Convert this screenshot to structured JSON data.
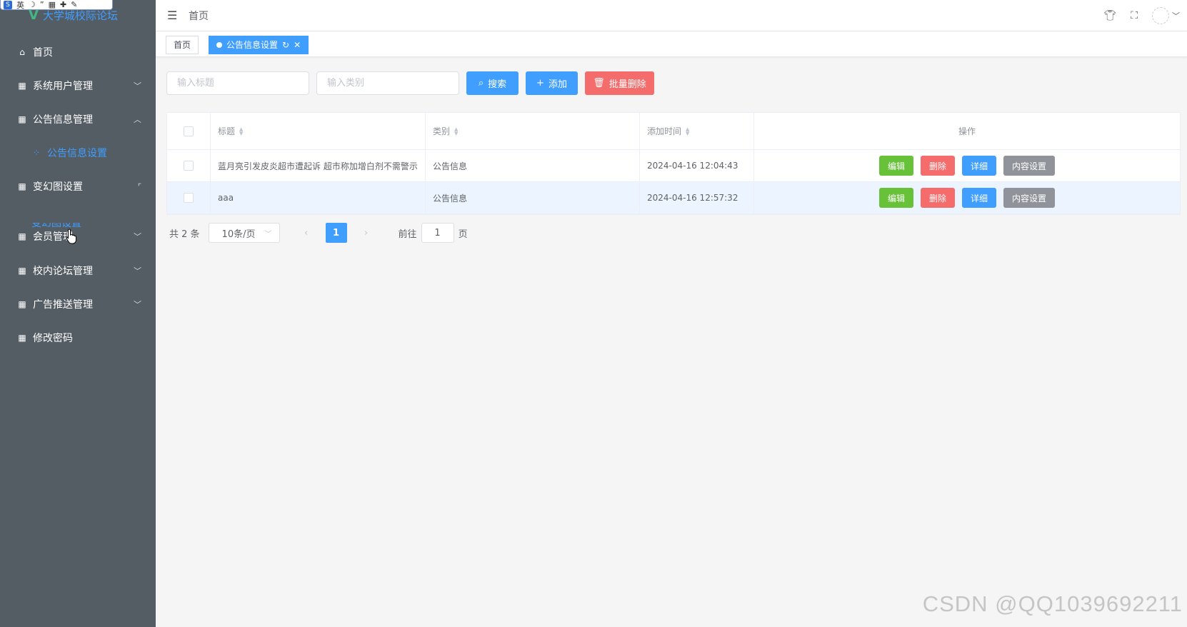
{
  "ime": {
    "label": "英"
  },
  "app": {
    "title": "大学城校际论坛"
  },
  "sidebar": {
    "items": [
      {
        "label": "首页",
        "icon": "home-icon"
      },
      {
        "label": "系统用户管理",
        "icon": "grid-icon",
        "chevron": "down"
      },
      {
        "label": "公告信息管理",
        "icon": "grid-icon",
        "chevron": "up"
      },
      {
        "label": "公告信息设置",
        "icon": "apps-icon",
        "sub": true
      },
      {
        "label": "变幻图设置",
        "icon": "grid-icon",
        "chevron": "collapsing"
      },
      {
        "label": "变幻图设置",
        "icon": "apps-icon",
        "sub": true,
        "partial": true
      },
      {
        "label": "会员管理",
        "icon": "grid-icon",
        "chevron": "down"
      },
      {
        "label": "校内论坛管理",
        "icon": "grid-icon",
        "chevron": "down"
      },
      {
        "label": "广告推送管理",
        "icon": "grid-icon",
        "chevron": "down"
      },
      {
        "label": "修改密码",
        "icon": "grid-icon"
      }
    ]
  },
  "header": {
    "breadcrumb": "首页"
  },
  "tags": [
    {
      "label": "首页",
      "active": false
    },
    {
      "label": "公告信息设置",
      "active": true
    }
  ],
  "search": {
    "title_placeholder": "输入标题",
    "type_placeholder": "输入类别",
    "search_label": "搜索",
    "add_label": "添加",
    "batch_delete_label": "批量删除"
  },
  "table": {
    "headers": {
      "title": "标题",
      "type": "类别",
      "time": "添加时间",
      "ops": "操作"
    },
    "rows": [
      {
        "title": "蓝月亮引发皮炎超市遭起诉 超市称加增白剂不需警示",
        "type": "公告信息",
        "time": "2024-04-16 12:04:43"
      },
      {
        "title": "aaa",
        "type": "公告信息",
        "time": "2024-04-16 12:57:32"
      }
    ],
    "ops": {
      "edit": "编辑",
      "delete": "删除",
      "detail": "详细",
      "content": "内容设置"
    }
  },
  "pagination": {
    "total": "共 2 条",
    "size": "10条/页",
    "current": "1",
    "goto_label": "前往",
    "goto_value": "1",
    "page_suffix": "页"
  },
  "watermark": "CSDN @QQ1039692211",
  "colors": {
    "sidebar": "#545c64",
    "primary": "#409eff",
    "success": "#67c23a",
    "danger": "#f56c6c",
    "info": "#909399"
  }
}
